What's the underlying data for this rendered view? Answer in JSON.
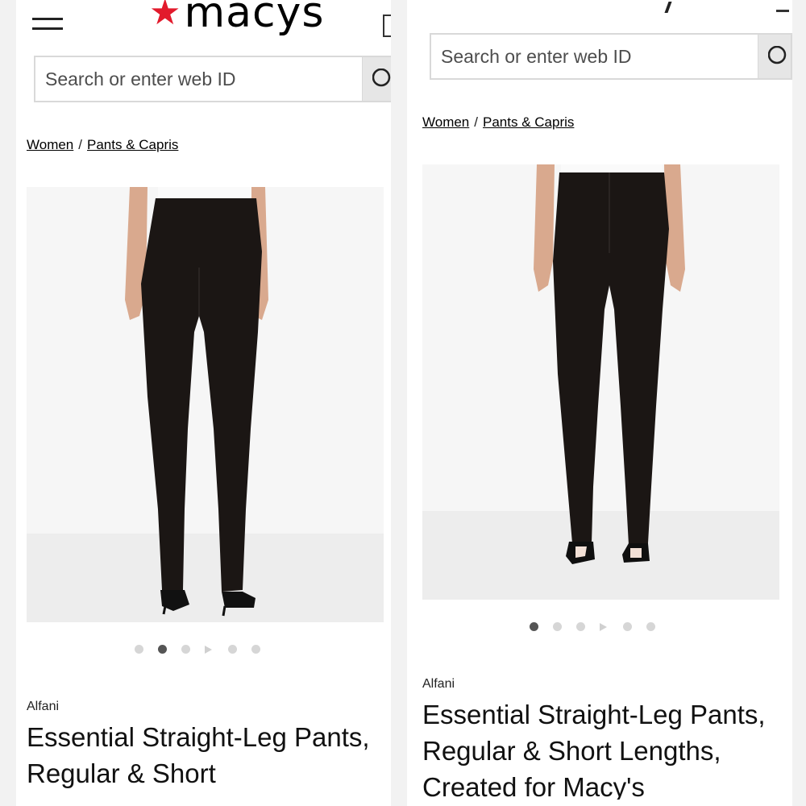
{
  "left": {
    "logo_text": "macys",
    "search": {
      "placeholder": "Search or enter web ID"
    },
    "breadcrumb": [
      {
        "label": "Women"
      },
      {
        "label": "Pants & Capris"
      }
    ],
    "image_alt": "Back view of black straight-leg pants",
    "carousel": {
      "count": 5,
      "active_index": 1,
      "has_video": true
    },
    "product": {
      "brand": "Alfani",
      "title": "Essential Straight-Leg Pants, Regular & Short"
    }
  },
  "right": {
    "search": {
      "placeholder": "Search or enter web ID"
    },
    "breadcrumb": [
      {
        "label": "Women"
      },
      {
        "label": "Pants & Capris"
      }
    ],
    "image_alt": "Front view of black straight-leg pants",
    "carousel": {
      "count": 5,
      "active_index": 0,
      "has_video": true
    },
    "product": {
      "brand": "Alfani",
      "title": "Essential Straight-Leg Pants, Regular & Short Lengths, Created for Macy's"
    }
  },
  "colors": {
    "brand_red": "#e21a2c",
    "pants": "#1b1614",
    "background": "#f7f7f7"
  },
  "icons": [
    "hamburger-icon",
    "star-icon",
    "bag-icon",
    "search-icon",
    "play-icon"
  ]
}
